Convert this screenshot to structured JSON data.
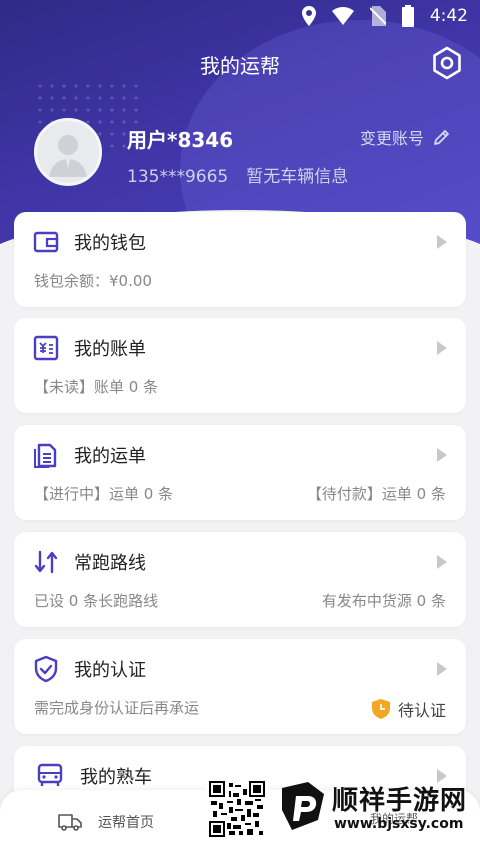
{
  "status_bar": {
    "time": "4:42"
  },
  "header": {
    "title": "我的运帮",
    "settings_icon": "gear-icon",
    "user_name": "用户*8346",
    "phone": "135***9665",
    "vehicle_info": "暂无车辆信息",
    "change_account_label": "变更账号"
  },
  "cards": [
    {
      "title": "我的钱包",
      "icon": "wallet-icon",
      "sub_left": "钱包余额：¥0.00",
      "sub_right": ""
    },
    {
      "title": "我的账单",
      "icon": "bill-icon",
      "sub_left": "【未读】账单 0 条",
      "sub_right": ""
    },
    {
      "title": "我的运单",
      "icon": "waybill-icon",
      "sub_left": "【进行中】运单 0 条",
      "sub_right": "【待付款】运单 0 条"
    },
    {
      "title": "常跑路线",
      "icon": "route-icon",
      "sub_left": "已设 0 条长跑路线",
      "sub_right": "有发布中货源 0 条"
    },
    {
      "title": "我的认证",
      "icon": "shield-check-icon",
      "sub_left": "需完成身份认证后再承运",
      "sub_right": "待认证"
    },
    {
      "title": "我的熟车",
      "icon": "truck-icon",
      "sub_left": "",
      "sub_right": ""
    }
  ],
  "bottom_nav": {
    "home_label": "运帮首页",
    "mine_label": "我的运帮"
  },
  "watermark": {
    "title": "顺祥手游网",
    "url": "www.bjsxsy.com"
  },
  "colors": {
    "accent": "#4a3fc4",
    "header_dark": "#2f2a86",
    "warning": "#f5a623"
  }
}
